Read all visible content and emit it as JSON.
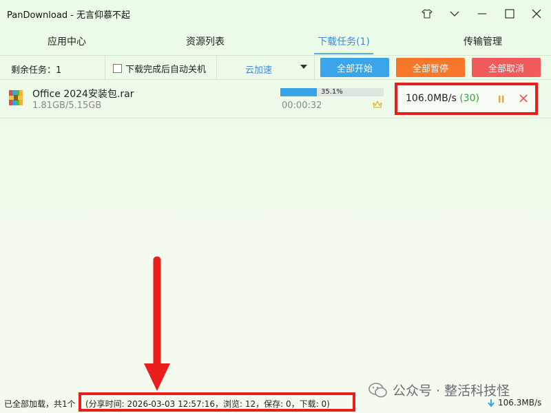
{
  "window": {
    "title": "PanDownload - 无言仰慕不起"
  },
  "tabs": [
    {
      "label": "应用中心"
    },
    {
      "label": "资源列表"
    },
    {
      "label": "下载任务(1)"
    },
    {
      "label": "传输管理"
    }
  ],
  "toolbar": {
    "remaining": "剩余任务：1",
    "shutdown_label": "下载完成后自动关机",
    "accel_label": "云加速",
    "start_all": "全部开始",
    "pause_all": "全部暂停",
    "cancel_all": "全部取消",
    "colors": {
      "start": "#3aa5ea",
      "pause": "#f7782b",
      "cancel": "#f05a5a"
    }
  },
  "download": {
    "name": "Office 2024安装包.rar",
    "size": "1.81GB/5.15GB",
    "progress_percent": 35.1,
    "progress_label": "35.1%",
    "elapsed": "00:00:32",
    "speed": "106.0MB/s",
    "connections": "(30)"
  },
  "status": {
    "loaded": "已全部加载，共1个",
    "share_info": "(分享时间: 2026-03-03 12:57:16，浏览: 12，保存: 0，下载: 0)",
    "total_speed": "106.3MB/s"
  },
  "watermark": {
    "text": "公众号 · 整活科技怪"
  },
  "icons": [
    "shirt-icon",
    "chevron-down-icon",
    "minimize-icon",
    "maximize-icon",
    "close-icon",
    "archive-icon",
    "crown-icon",
    "pause-icon",
    "cancel-icon",
    "download-arrow-icon",
    "wechat-icon"
  ]
}
